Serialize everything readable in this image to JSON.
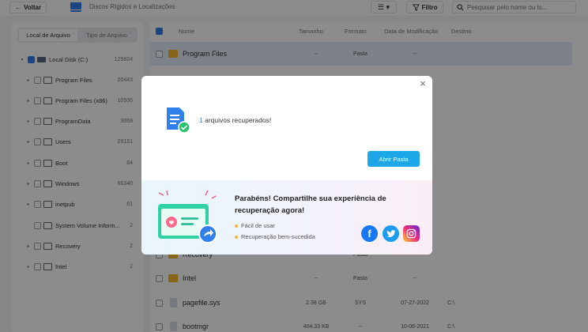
{
  "topbar": {
    "back_label": "Voltar",
    "location_title": "Discos Rígidos e Localizações",
    "menu_label": "☰ ▾",
    "filter_label": "Filtro",
    "search_placeholder": "Pesquisar pelo nome ou lo..."
  },
  "sidebar": {
    "tabs": [
      "Local de Arquivo",
      "Tipo de Arquivo"
    ],
    "root": {
      "label": "Local Disk (C:)",
      "count": "129824"
    },
    "items": [
      {
        "label": "Program Files",
        "count": "20443"
      },
      {
        "label": "Program Files (x86)",
        "count": "10936"
      },
      {
        "label": "ProgramData",
        "count": "3069"
      },
      {
        "label": "Users",
        "count": "29151"
      },
      {
        "label": "Boot",
        "count": "84"
      },
      {
        "label": "Windows",
        "count": "66340"
      },
      {
        "label": "inetpub",
        "count": "61"
      },
      {
        "label": "System Volume Inform...",
        "count": "2"
      },
      {
        "label": "Recovery",
        "count": "2"
      },
      {
        "label": "Intel",
        "count": "2"
      }
    ]
  },
  "table": {
    "headers": {
      "name": "Nome",
      "size": "Tamanho",
      "format": "Formato",
      "date": "Data de Modificação",
      "dest": "Destino"
    },
    "rows": [
      {
        "name": "Program Files",
        "size": "--",
        "format": "Pasta",
        "date": "--",
        "dest": ""
      },
      {
        "name": "Recovery",
        "size": "--",
        "format": "Pasta",
        "date": "",
        "dest": ""
      },
      {
        "name": "Intel",
        "size": "--",
        "format": "Pasta",
        "date": "--",
        "dest": ""
      },
      {
        "name": "pagefile.sys",
        "size": "2.38 GB",
        "format": "SYS",
        "date": "07-27-2022",
        "dest": "C:\\"
      },
      {
        "name": "bootmgr",
        "size": "404.33 KB",
        "format": "--",
        "date": "10-06-2021",
        "dest": "C:\\"
      }
    ]
  },
  "modal": {
    "count": "1",
    "message": " arquivos recuperados!",
    "open_button": "Abrir Pasta",
    "promo_title": "Parabéns! Compartilhe sua experiência de recuperação agora!",
    "bullets": [
      "Fácil de usar",
      "Recuperação bem-sucedida"
    ],
    "close_symbol": "×"
  },
  "icons": {
    "facebook": "facebook-icon",
    "twitter": "twitter-icon",
    "instagram": "instagram-icon"
  },
  "colors": {
    "accent": "#2f80ed",
    "button": "#1ea7e8",
    "folder": "#f5b731"
  }
}
